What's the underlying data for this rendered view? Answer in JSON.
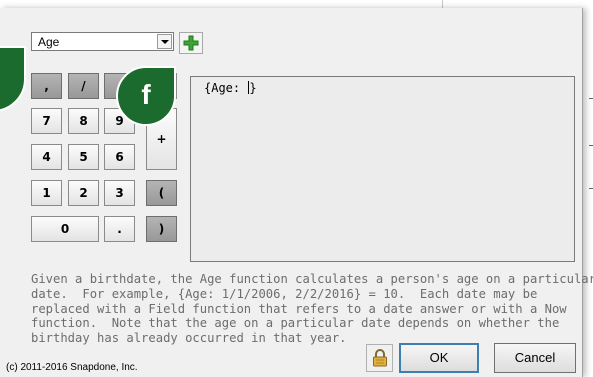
{
  "dialog": {
    "function_dropdown": {
      "selected": "Age"
    },
    "add_button": {
      "icon": "plus-icon",
      "color": "#3aa532"
    },
    "callouts": {
      "right_letter": "f",
      "color": "#1b6b2e"
    },
    "keypad": {
      "comma": ",",
      "slash": "/",
      "seven": "7",
      "eight": "8",
      "nine": "9",
      "plus": "+",
      "four": "4",
      "five": "5",
      "six": "6",
      "one": "1",
      "two": "2",
      "three": "3",
      "open_paren": "(",
      "zero": "0",
      "dot": ".",
      "close_paren": ")"
    },
    "formula": {
      "text": "{Age: ",
      "closing": "}"
    },
    "description": {
      "lines": [
        "Given a birthdate, the Age function calculates a person's age on a particular",
        "date.  For example, {Age: 1/1/2006, 2/2/2016} = 10.  Each date may be",
        "replaced with a Field function that refers to a date answer or with a Now",
        "function.  Note that the age on a particular date depends on whether the",
        "birthday has already occurred in that year."
      ]
    },
    "copyright": "(c) 2011-2016 Snapdone, Inc.",
    "buttons": {
      "ok": "OK",
      "cancel": "Cancel",
      "lock_icon": "lock-icon"
    }
  }
}
